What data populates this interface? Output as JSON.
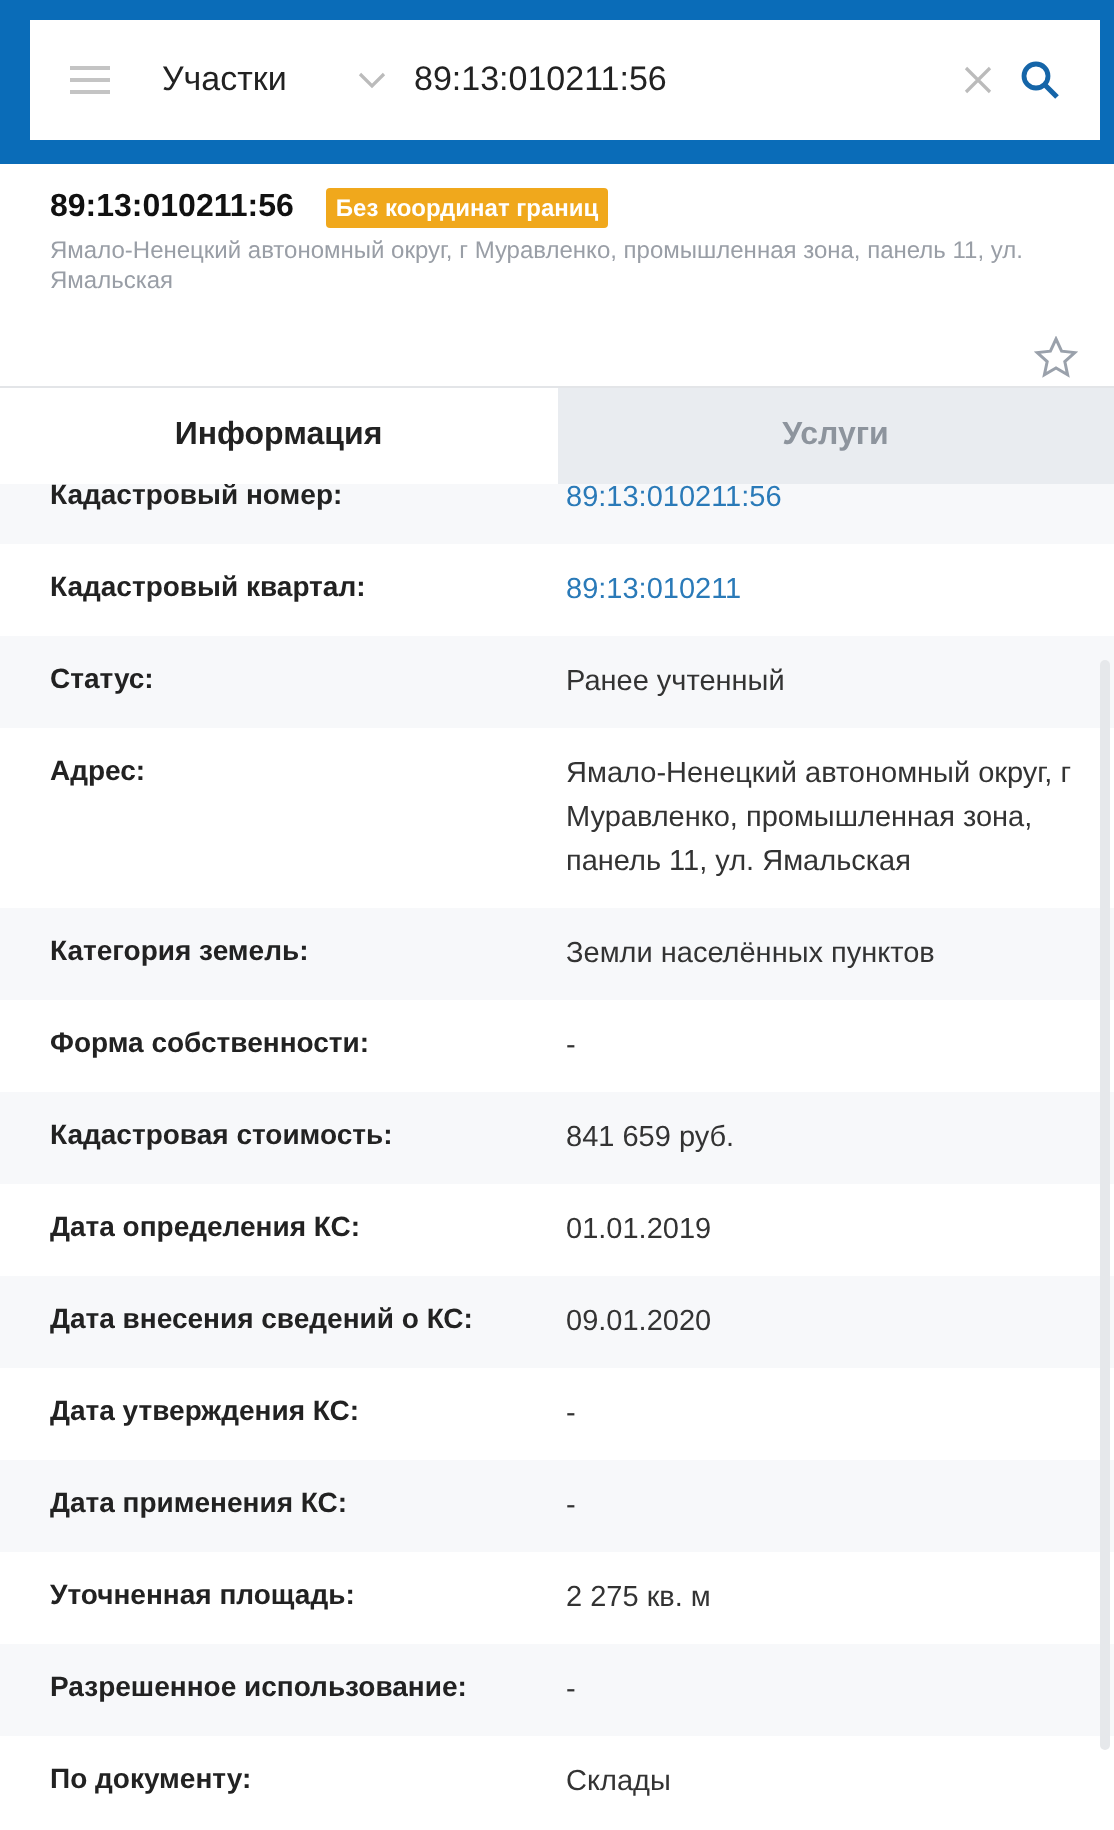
{
  "search": {
    "category": "Участки",
    "value": "89:13:010211:56"
  },
  "object": {
    "title": "89:13:010211:56",
    "badge": "Без координат границ",
    "address": "Ямало-Ненецкий автономный округ, г Муравленко, промышленная зона, панель 11, ул. Ямальская",
    "favorite": false
  },
  "tabs": [
    {
      "label": "Информация",
      "selected": true
    },
    {
      "label": "Услуги",
      "selected": false
    }
  ],
  "rows": [
    {
      "label": "Кадастровый номер:",
      "value": "89:13:010211:56",
      "kind": "link"
    },
    {
      "label": "Кадастровый квартал:",
      "value": "89:13:010211",
      "kind": "link"
    },
    {
      "label": "Статус:",
      "value": "Ранее учтенный",
      "kind": "text"
    },
    {
      "label": "Адрес:",
      "value": "Ямало-Ненецкий автономный округ, г Муравленко, промышленная зона, панель 11, ул. Ямальская",
      "kind": "text"
    },
    {
      "label": "Категория земель:",
      "value": "Земли населённых пунктов",
      "kind": "text"
    },
    {
      "label": "Форма собственности:",
      "value": "-",
      "kind": "text"
    },
    {
      "label": "Кадастровая стоимость:",
      "value": "841 659 руб.",
      "kind": "text"
    },
    {
      "label": "Дата определения КС:",
      "value": "01.01.2019",
      "kind": "text"
    },
    {
      "label": "Дата внесения сведений о КС:",
      "value": "09.01.2020",
      "kind": "text"
    },
    {
      "label": "Дата утверждения КС:",
      "value": "-",
      "kind": "text"
    },
    {
      "label": "Дата применения КС:",
      "value": "-",
      "kind": "text"
    },
    {
      "label": "Уточненная площадь:",
      "value": "2 275 кв. м",
      "kind": "text"
    },
    {
      "label": "Разрешенное использование:",
      "value": "-",
      "kind": "text"
    },
    {
      "label": "По документу:",
      "value": "Склады",
      "kind": "text"
    }
  ]
}
